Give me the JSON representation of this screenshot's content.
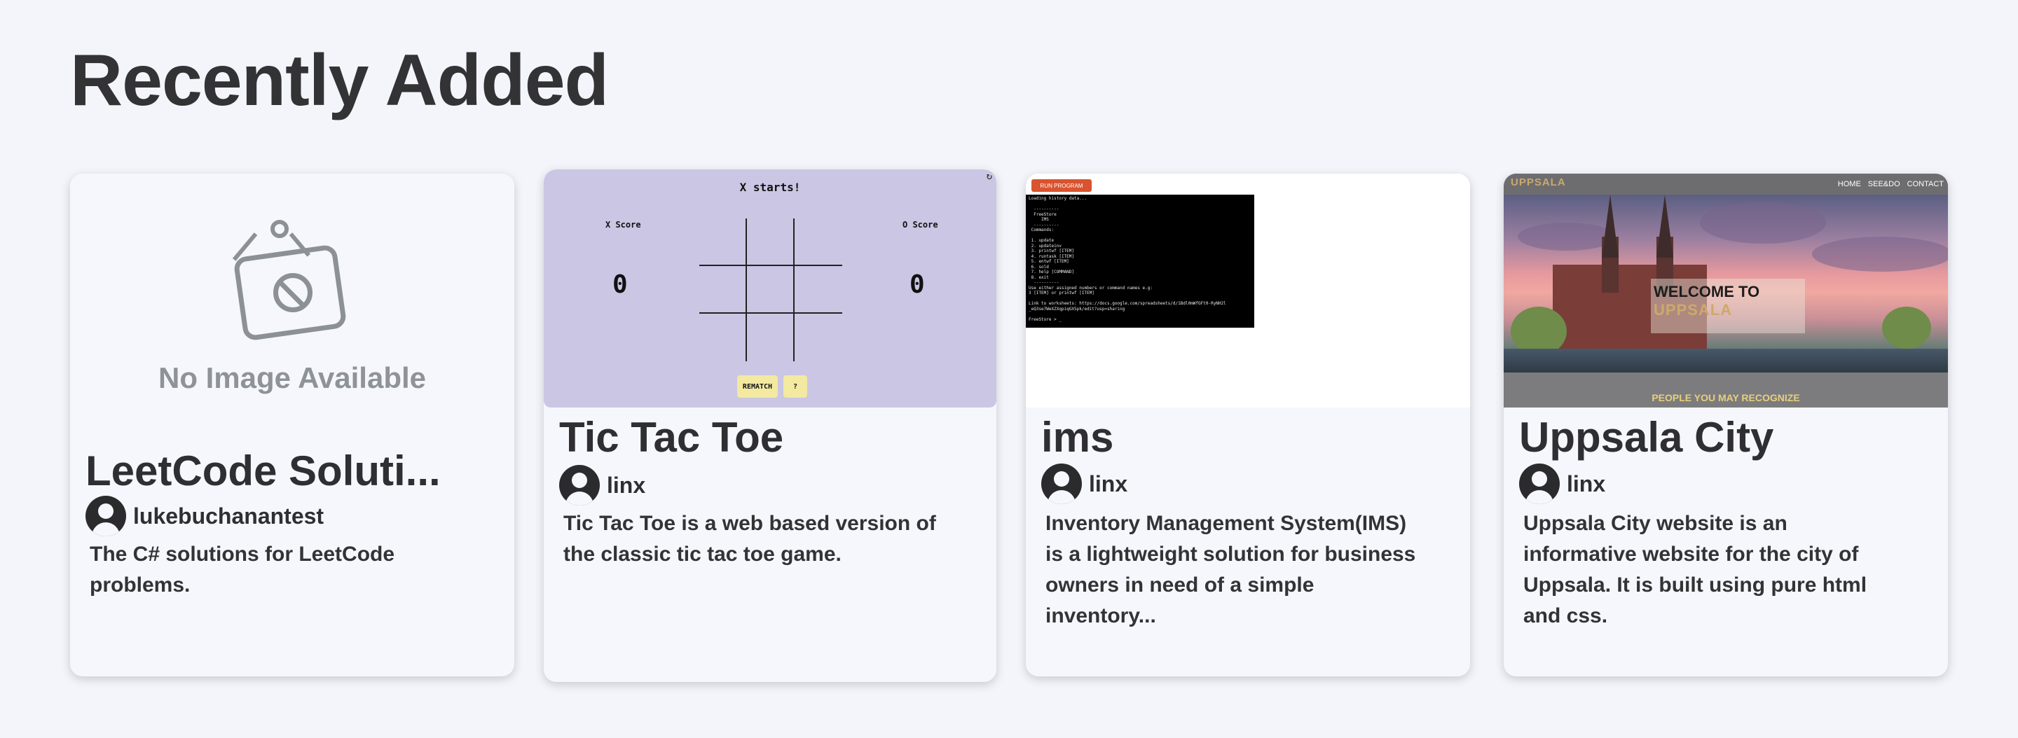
{
  "page": {
    "title": "Recently Added"
  },
  "cards": [
    {
      "title": "LeetCode Soluti...",
      "author": "lukebuchanantest",
      "description": "The C# solutions for LeetCode problems.",
      "thumbnail": {
        "type": "placeholder",
        "text": "No Image Available",
        "icon": "no-image-sign-icon"
      }
    },
    {
      "title": "Tic Tac Toe",
      "author": "linx",
      "description": "Tic Tac Toe is a web based version of the classic tic tac toe game.",
      "thumbnail": {
        "type": "screenshot",
        "status": "X starts!",
        "x_label": "X Score",
        "o_label": "O Score",
        "x_score": "0",
        "o_score": "0",
        "rematch_label": "REMATCH",
        "help_label": "?",
        "background": "#cac6e3"
      }
    },
    {
      "title": "ims",
      "author": "linx",
      "description": "Inventory Management System(IMS) is a lightweight solution for business owners in need of a simple inventory...",
      "thumbnail": {
        "type": "screenshot",
        "run_label": "RUN PROGRAM",
        "terminal": "Loading history data...\n\n  ----------\n  FreeStore\n     IMS\n  ----------\n Commands:\n\n 1. update\n 2. updateinv\n 3. printwf [ITEM]\n 4. runtask [ITEM]\n 5. entwf [ITEM]\n 6. sold\n 7. help [COMMAND]\n 8. exit\n  ----------\nUse either assigned numbers or command names e.g:\n3 [ITEM] or printwf [ITEM]\n\nLink to worksheets: https://docs.google.com/spreadsheets/d/1Bdl0mWfGFt0-RyNH2l\n_eQ3se7WeXZXqpiqGX5pk/edit?usp=sharing\n\nFreeStore > _"
      }
    },
    {
      "title": "Uppsala City",
      "author": "linx",
      "description": "Uppsala City website is an informative website for the city of Uppsala. It is built using pure html and css.",
      "thumbnail": {
        "type": "screenshot",
        "logo": "UPPSALA",
        "nav": [
          "HOME",
          "SEE&DO",
          "CONTACT"
        ],
        "welcome_line1": "WELCOME TO",
        "welcome_line2": "UPPSALA",
        "footer": "PEOPLE YOU MAY RECOGNIZE"
      }
    }
  ]
}
